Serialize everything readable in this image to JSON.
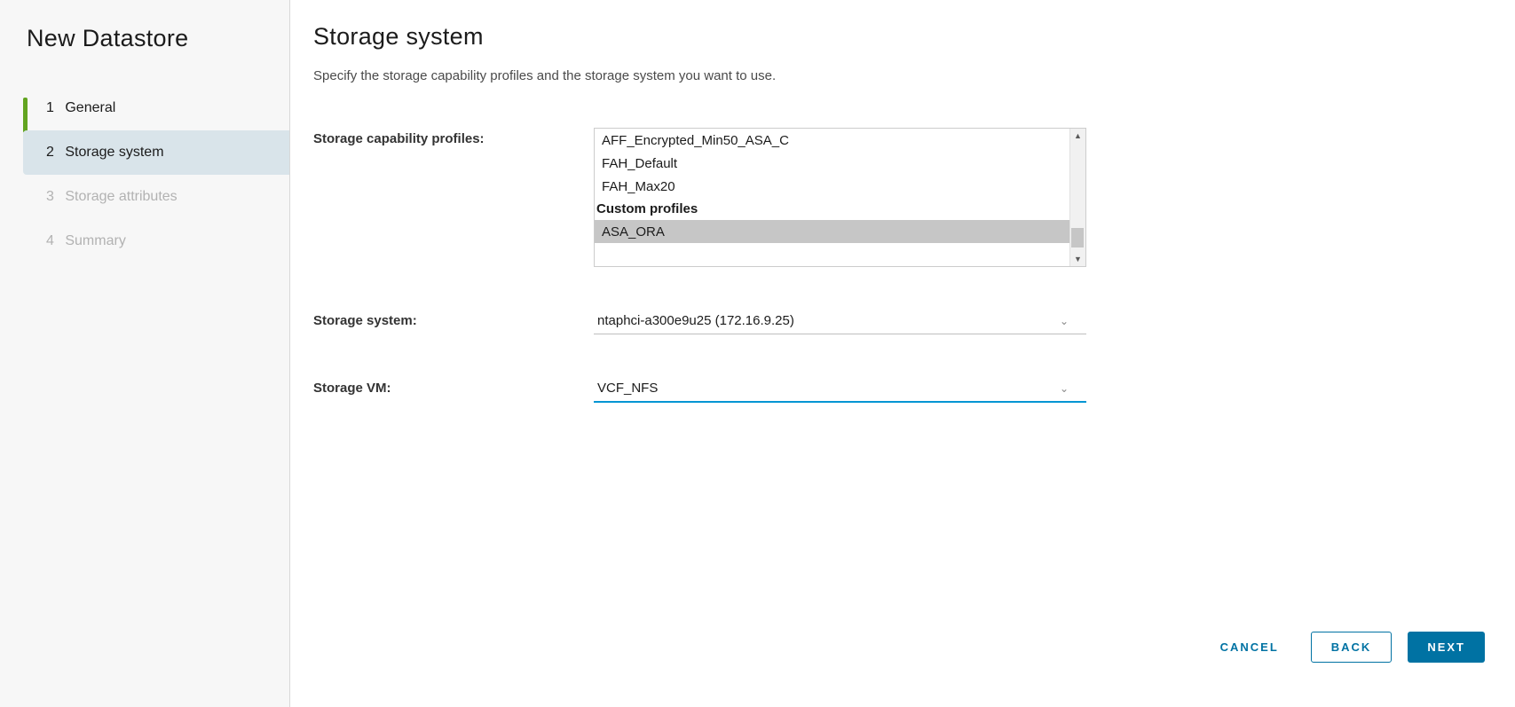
{
  "wizard": {
    "title": "New Datastore",
    "steps": [
      {
        "num": "1",
        "label": "General",
        "state": "completed"
      },
      {
        "num": "2",
        "label": "Storage system",
        "state": "current"
      },
      {
        "num": "3",
        "label": "Storage attributes",
        "state": "future"
      },
      {
        "num": "4",
        "label": "Summary",
        "state": "future"
      }
    ]
  },
  "page": {
    "title": "Storage system",
    "description": "Specify the storage capability profiles and the storage system you want to use."
  },
  "labels": {
    "capability_profiles": "Storage capability profiles:",
    "storage_system": "Storage system:",
    "storage_vm": "Storage VM:"
  },
  "profiles": {
    "items": [
      {
        "text": "AFF_Encrypted_Min50_ASA_C",
        "type": "item"
      },
      {
        "text": "FAH_Default",
        "type": "item"
      },
      {
        "text": "FAH_Max20",
        "type": "item"
      },
      {
        "text": "Custom profiles",
        "type": "group"
      },
      {
        "text": "ASA_ORA",
        "type": "item",
        "selected": true
      }
    ]
  },
  "storage_system": {
    "value": "ntaphci-a300e9u25 (172.16.9.25)"
  },
  "storage_vm": {
    "value": "VCF_NFS"
  },
  "footer": {
    "cancel": "CANCEL",
    "back": "BACK",
    "next": "NEXT"
  }
}
